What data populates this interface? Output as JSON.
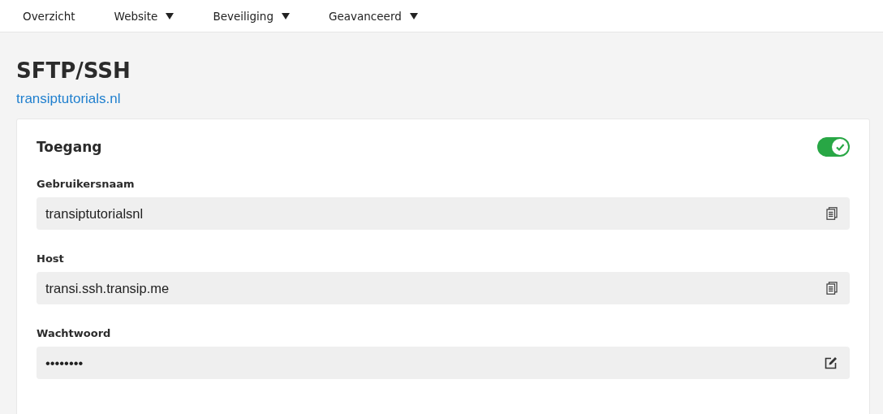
{
  "nav": [
    {
      "label": "Overzicht",
      "dropdown": false
    },
    {
      "label": "Website",
      "dropdown": true
    },
    {
      "label": "Beveiliging",
      "dropdown": true
    },
    {
      "label": "Geavanceerd",
      "dropdown": true
    }
  ],
  "page": {
    "title": "SFTP/SSH",
    "domain": "transiptutorials.nl"
  },
  "card": {
    "title": "Toegang",
    "toggle": {
      "on": true
    },
    "fields": [
      {
        "label": "Gebruikersnaam",
        "value": "transiptutorialsnl",
        "kind": "copy"
      },
      {
        "label": "Host",
        "value": "transi.ssh.transip.me",
        "kind": "copy"
      },
      {
        "label": "Wachtwoord",
        "value": "••••••••",
        "kind": "edit"
      }
    ]
  }
}
